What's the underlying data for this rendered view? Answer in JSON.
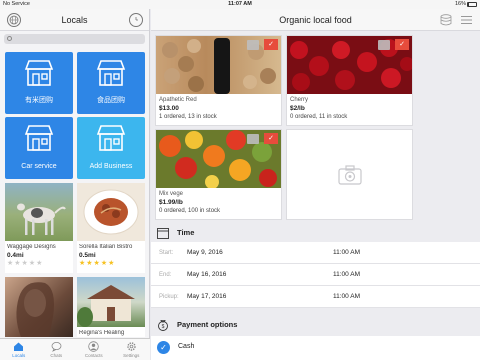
{
  "status_bar": {
    "carrier": "No Service",
    "time": "11:07 AM",
    "battery": "16%"
  },
  "left_nav": {
    "title": "Locals",
    "left_icon": "globe-icon",
    "right_icon": "clock-icon"
  },
  "search": {
    "placeholder": ""
  },
  "categories": [
    {
      "label": "有米团购",
      "color": "#2e86e6"
    },
    {
      "label": "食品团购",
      "color": "#2e86e6"
    },
    {
      "label": "Car service",
      "color": "#2e86e6"
    },
    {
      "label": "Add Business",
      "color": "#3cb6ee"
    }
  ],
  "businesses": [
    {
      "name": "Waggage Designs",
      "distance": "0.4mi",
      "stars": 0
    },
    {
      "name": "Sorella Italian Bistro",
      "distance": "0.5mi",
      "stars": 5
    },
    {
      "name": "",
      "distance": "",
      "stars": null
    },
    {
      "name": "Regina's Healing",
      "distance": "",
      "stars": null
    }
  ],
  "tabbar": {
    "tabs": [
      {
        "label": "Locals",
        "icon": "home-icon",
        "active": true
      },
      {
        "label": "Chats",
        "icon": "chat-icon",
        "active": false
      },
      {
        "label": "Contacts",
        "icon": "contacts-icon",
        "active": false
      },
      {
        "label": "Settings",
        "icon": "gear-icon",
        "active": false
      }
    ]
  },
  "right_nav": {
    "title": "Organic local food",
    "icons": [
      "database-icon",
      "menu-icon"
    ]
  },
  "products": [
    {
      "name": "Apathetic Red",
      "price": "$13.00",
      "stock": "1 ordered, 13 in stock"
    },
    {
      "name": "Cherry",
      "price": "$2/lb",
      "stock": "0 ordered, 11 in stock"
    },
    {
      "name": "Mix vege",
      "price": "$1.99/lb",
      "stock": "0 ordered, 100 in stock"
    }
  ],
  "time_section": {
    "title": "Time",
    "rows": [
      {
        "key": "Start:",
        "date": "May 9, 2016",
        "time": "11:00 AM"
      },
      {
        "key": "End:",
        "date": "May 16, 2016",
        "time": "11:00 AM"
      },
      {
        "key": "Pickup:",
        "date": "May 17, 2016",
        "time": "11:00 AM"
      }
    ]
  },
  "payment_section": {
    "title": "Payment options",
    "options": [
      {
        "label": "Cash",
        "selected": true
      }
    ]
  },
  "colors": {
    "accent": "#2e86e6",
    "accent_light": "#3cb6ee",
    "badge_red": "#e74c3c",
    "star": "#f6c223"
  }
}
